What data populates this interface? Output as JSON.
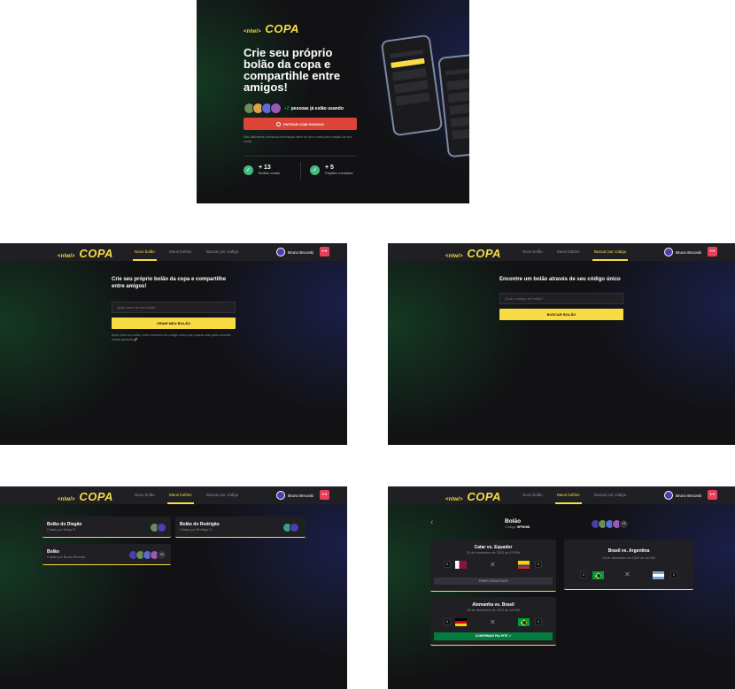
{
  "logo": {
    "tag": "<nlw/>",
    "copa": "COPA"
  },
  "hero": {
    "title": "Crie seu próprio bolão da copa e compartihle entre amigos!",
    "users_text_count": "+2",
    "users_text": "pessoas já estão usando",
    "google_button": "ENTRAR COM GOOGLE",
    "disclaimer": "Não utilizamos nenhuma informação além do seu e-mail para criação de sua conta.",
    "stat1_value": "+ 13",
    "stat1_label": "Bolões criado",
    "stat2_value": "+ 5",
    "stat2_label": "Palpites enviados"
  },
  "nav": {
    "tab_new": "Novo bolão",
    "tab_mine": "Meus bolões",
    "tab_search": "Buscar por código",
    "user_name": "Bruno Becoski"
  },
  "create": {
    "title": "Crie seu próprio bolão da copa e compartilhe entre amigos!",
    "placeholder": "Qual nome do seu bolão",
    "button": "CRIAR MEU BOLÃO",
    "note": "Após criar seu bolão, você receberá um código único que poderá usar para convidar outras pessoas 🚀"
  },
  "find": {
    "title": "Encontre um bolão através de seu código único",
    "placeholder": "Qual o código do bolão?",
    "button": "BUSCAR BOLÃO"
  },
  "pools": [
    {
      "name": "Bolão do Diegão",
      "owner": "Criado por Diego F."
    },
    {
      "name": "Bolão do Rodrigão",
      "owner": "Criado por Rodrigo G."
    },
    {
      "name": "Bolão",
      "owner": "Criado por Bruno Becoski",
      "more": "+3"
    }
  ],
  "detail": {
    "title": "Bolão",
    "code_label": "Código:",
    "code": "9P9G08",
    "more": "+3",
    "games": [
      {
        "teams": "Catar vs. Equador",
        "date": "20 de novembro de 2022 às 13:00h",
        "home_score": "0",
        "away_score": "0",
        "bar": "TEMPO ESGOTADO"
      },
      {
        "teams": "Brasil vs. Argentina",
        "date": "14 de dezembro de 2022 às 16:00h",
        "home_score": "2",
        "away_score": "2"
      },
      {
        "teams": "Alemanha vs. Brasil",
        "date": "16 de dezembro de 2022 às 12:00h",
        "home_score": "0",
        "away_score": "0",
        "bar": "CONFIRMAR PALPITE"
      }
    ]
  },
  "colors": {
    "accent": "#f7dd43",
    "bg": "#121214",
    "card": "#202024",
    "red": "#db4437",
    "green": "#047c3f"
  }
}
